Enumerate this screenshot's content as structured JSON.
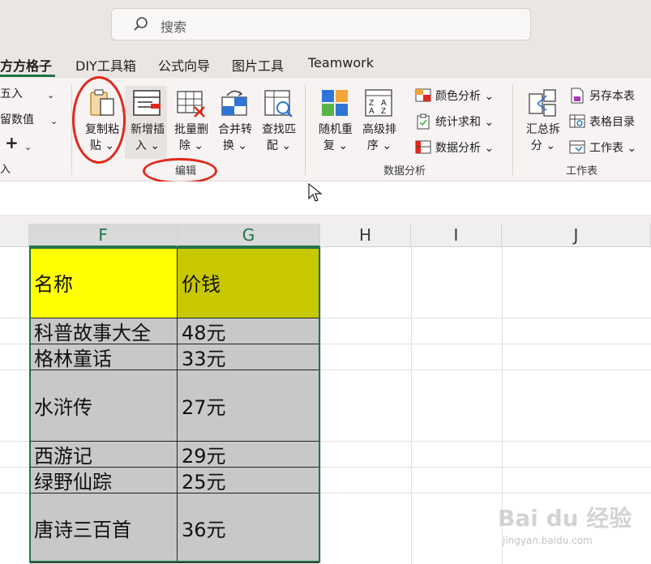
{
  "search": {
    "placeholder": "搜索"
  },
  "tabs": [
    "方方格子",
    "DIY工具箱",
    "公式向导",
    "图片工具",
    "Teamwork"
  ],
  "ribbon": {
    "left_partial": [
      "五入",
      "留数值",
      "+",
      "入"
    ],
    "edit_group": {
      "label": "编辑",
      "buttons": [
        {
          "line1": "复制粘",
          "line2": "贴"
        },
        {
          "line1": "新增插",
          "line2": "入"
        },
        {
          "line1": "批量删",
          "line2": "除"
        },
        {
          "line1": "合并转",
          "line2": "换"
        },
        {
          "line1": "查找匹",
          "line2": "配"
        }
      ]
    },
    "data_group": {
      "label": "数据分析",
      "buttons": [
        {
          "line1": "随机重",
          "line2": "复"
        },
        {
          "line1": "高级排",
          "line2": "序"
        }
      ],
      "small": [
        "颜色分析",
        "统计求和",
        "数据分析"
      ]
    },
    "sheet_group": {
      "label": "工作表",
      "button": {
        "line1": "汇总拆",
        "line2": "分"
      },
      "small": [
        "另存本表",
        "表格目录",
        "工作表"
      ]
    }
  },
  "columns": [
    "F",
    "G",
    "H",
    "I",
    "J"
  ],
  "table": {
    "header": [
      "名称",
      "价钱"
    ],
    "rows": [
      [
        "科普故事大全",
        "48元"
      ],
      [
        "格林童话",
        "33元"
      ],
      [
        "水浒传",
        "27元"
      ],
      [
        "西游记",
        "29元"
      ],
      [
        "绿野仙踪",
        "25元"
      ],
      [
        "唐诗三百首",
        "36元"
      ]
    ]
  },
  "watermark": {
    "brand": "Bai du 经验",
    "url": "jingyan.baidu.com"
  },
  "colors": {
    "accent": "#217346",
    "header_f": "#ffff00",
    "header_g": "#c8c800",
    "cell_fill": "#c8c8c8",
    "annotation": "#e0281b"
  }
}
